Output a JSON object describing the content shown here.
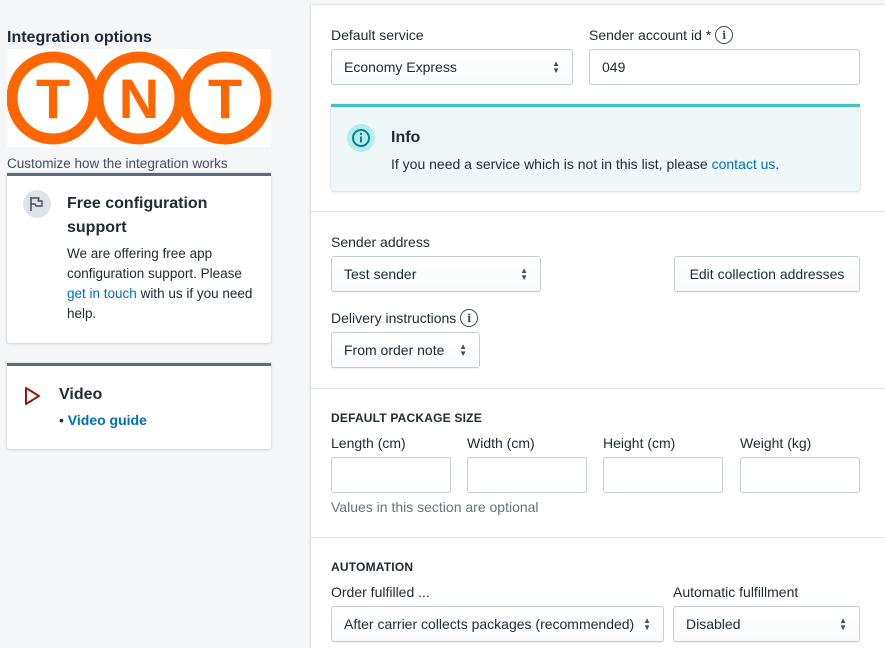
{
  "sidebar": {
    "title": "Integration options",
    "logo_text": [
      "T",
      "N",
      "T"
    ],
    "description": "Customize how the integration works",
    "support_card": {
      "title": "Free configuration support",
      "body_before": "We are offering free app configuration support. Please ",
      "link": "get in touch",
      "body_after": " with us if you need help."
    },
    "video_card": {
      "title": "Video",
      "bullet": "• ",
      "link": "Video guide"
    }
  },
  "form": {
    "default_service": {
      "label": "Default service",
      "value": "Economy Express"
    },
    "sender_account": {
      "label": "Sender account id *",
      "value": "049"
    },
    "info_banner": {
      "title": "Info",
      "text_before": "If you need a service which is not in this list, please ",
      "link": "contact us",
      "text_after": "."
    },
    "sender_address": {
      "label": "Sender address",
      "value": "Test sender"
    },
    "edit_addresses_button": "Edit collection addresses",
    "delivery_instructions": {
      "label": "Delivery instructions",
      "value": "From order note"
    },
    "package_size": {
      "heading": "DEFAULT PACKAGE SIZE",
      "fields": [
        {
          "label": "Length (cm)",
          "value": ""
        },
        {
          "label": "Width (cm)",
          "value": ""
        },
        {
          "label": "Height (cm)",
          "value": ""
        },
        {
          "label": "Weight (kg)",
          "value": ""
        }
      ],
      "help": "Values in this section are optional"
    },
    "automation": {
      "heading": "AUTOMATION",
      "order_fulfilled": {
        "label": "Order fulfilled ...",
        "value": "After carrier collects packages (recommended)"
      },
      "auto_fulfillment": {
        "label": "Automatic fulfillment",
        "value": "Disabled"
      }
    }
  },
  "colors": {
    "brand_orange": "#ff6600",
    "link": "#006fbb",
    "info_accent": "#47c1bf",
    "card_border": "#5c6b7a",
    "video_icon": "#8e1f0b"
  },
  "icons": {
    "info": "info-icon",
    "support": "flag-icon",
    "video": "play-icon",
    "select": "chevron-up-down-icon"
  }
}
